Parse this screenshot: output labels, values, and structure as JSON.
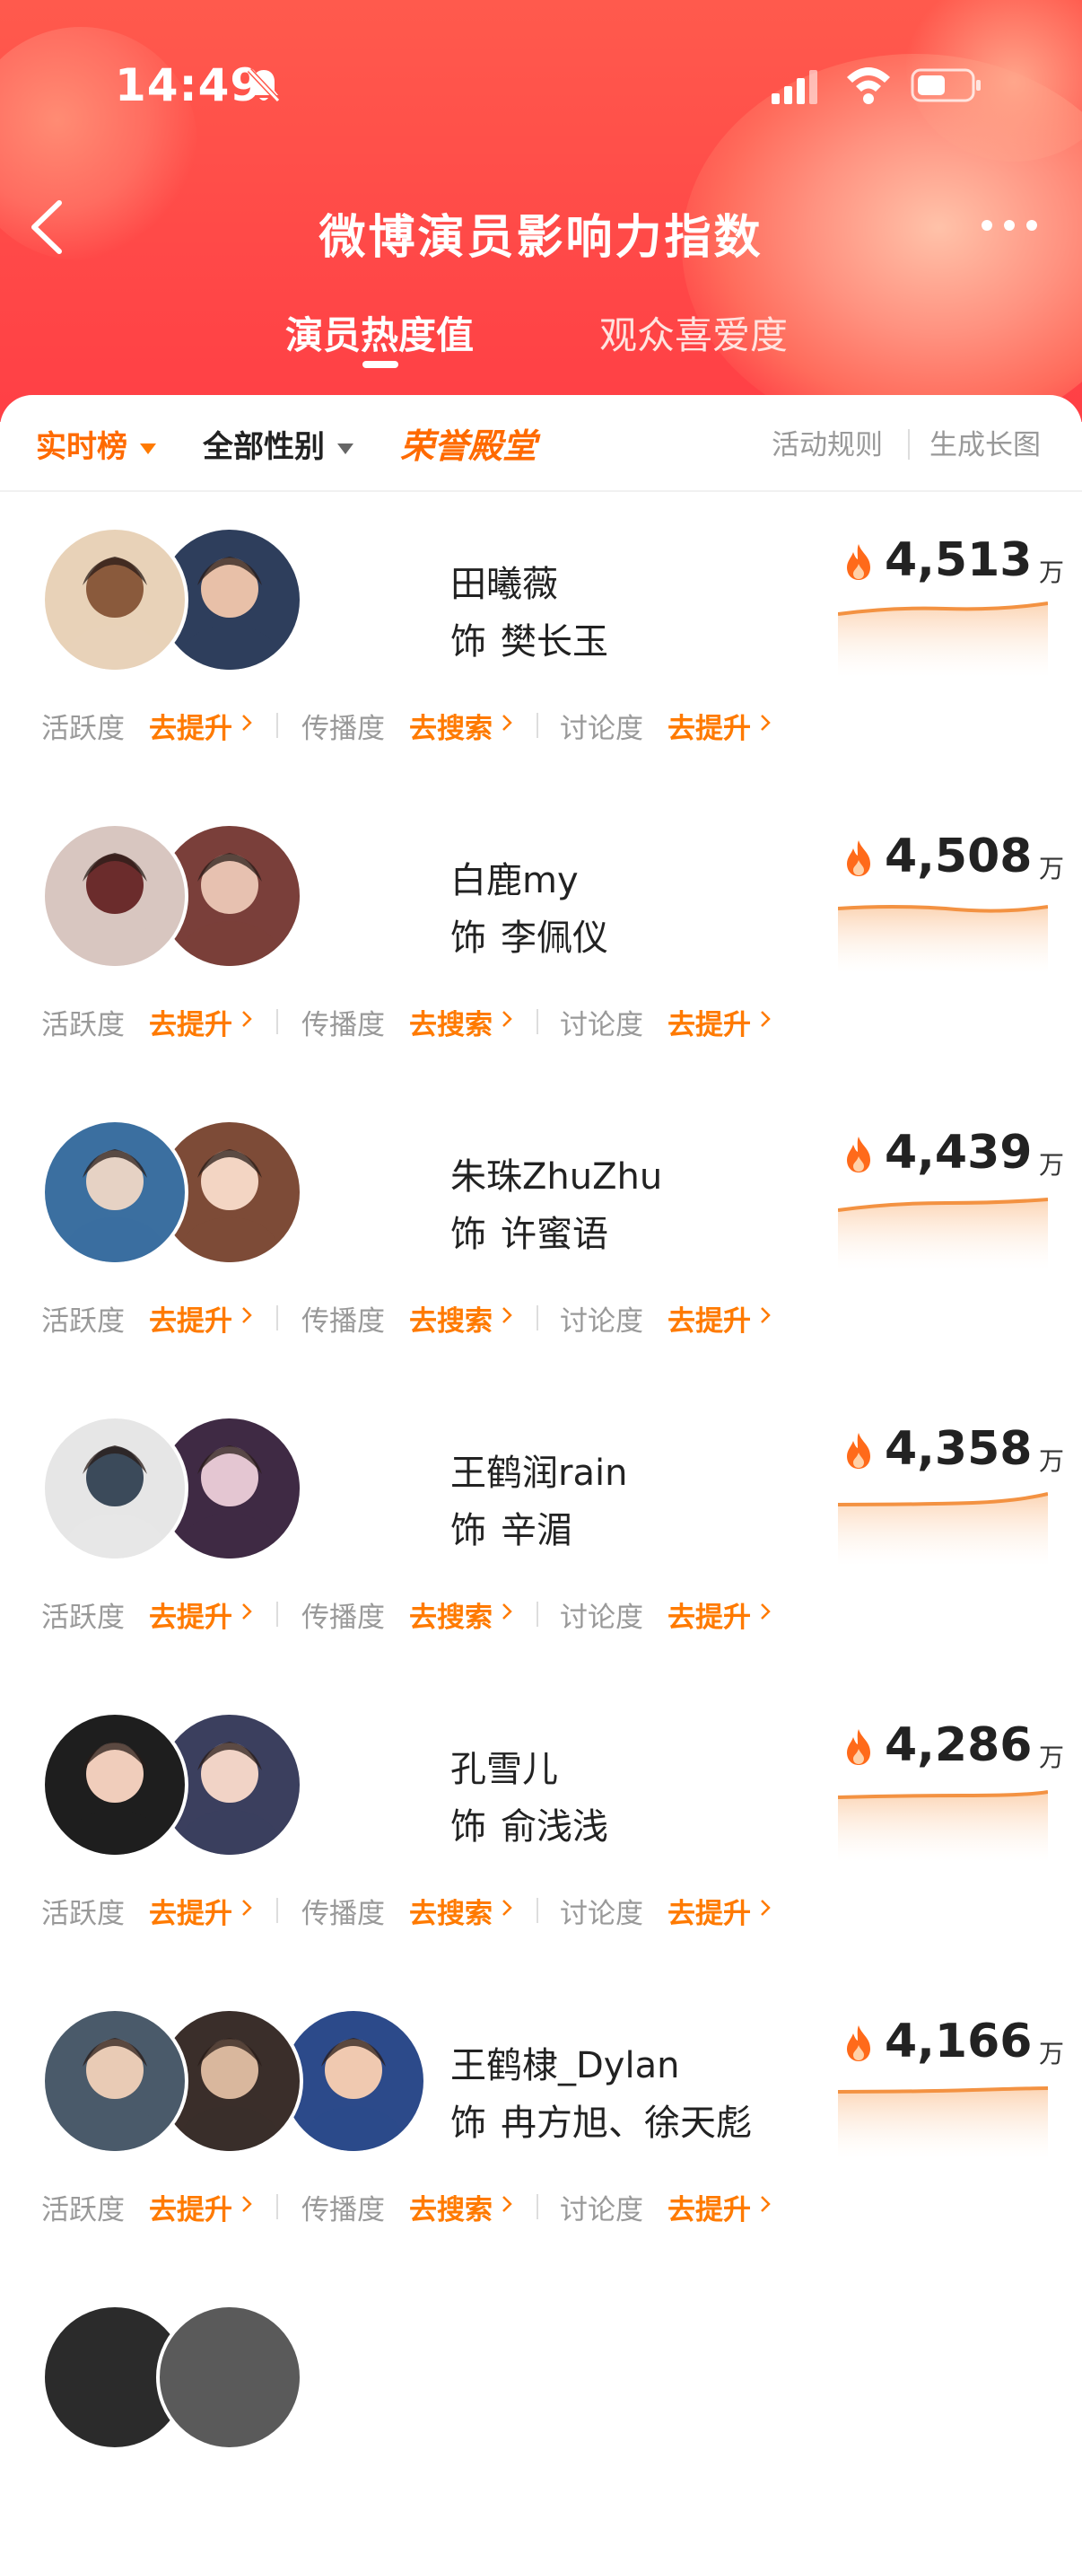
{
  "status_bar": {
    "time": "14:49"
  },
  "nav": {
    "title": "微博演员影响力指数"
  },
  "tabs": [
    {
      "label": "演员热度值",
      "active": true
    },
    {
      "label": "观众喜爱度",
      "active": false
    }
  ],
  "filters": {
    "realtime": "实时榜",
    "gender": "全部性别",
    "hall_of_fame": "荣誉殿堂",
    "rules": "活动规则",
    "long_image": "生成长图"
  },
  "colors": {
    "accent": "#ff6a00",
    "header": "#ff4a48",
    "trend": "#f59a4a"
  },
  "metric_labels": {
    "activity": "活跃度",
    "spread": "传播度",
    "discussion": "讨论度"
  },
  "metric_actions": {
    "boost": "去提升",
    "search": "去搜索"
  },
  "unit": "万",
  "role_prefix": "饰",
  "rows": [
    {
      "name": "田曦薇",
      "role": "樊长玉",
      "score": "4,513",
      "avatars": 2
    },
    {
      "name": "白鹿my",
      "role": "李佩仪",
      "score": "4,508",
      "avatars": 2
    },
    {
      "name": "朱珠ZhuZhu",
      "role": "许蜜语",
      "score": "4,439",
      "avatars": 2
    },
    {
      "name": "王鹤润rain",
      "role": "辛湄",
      "score": "4,358",
      "avatars": 2
    },
    {
      "name": "孔雪儿",
      "role": "俞浅浅",
      "score": "4,286",
      "avatars": 2
    },
    {
      "name": "王鹤棣_Dylan",
      "role": "冉方旭、徐天彪",
      "score": "4,166",
      "avatars": 3
    }
  ]
}
